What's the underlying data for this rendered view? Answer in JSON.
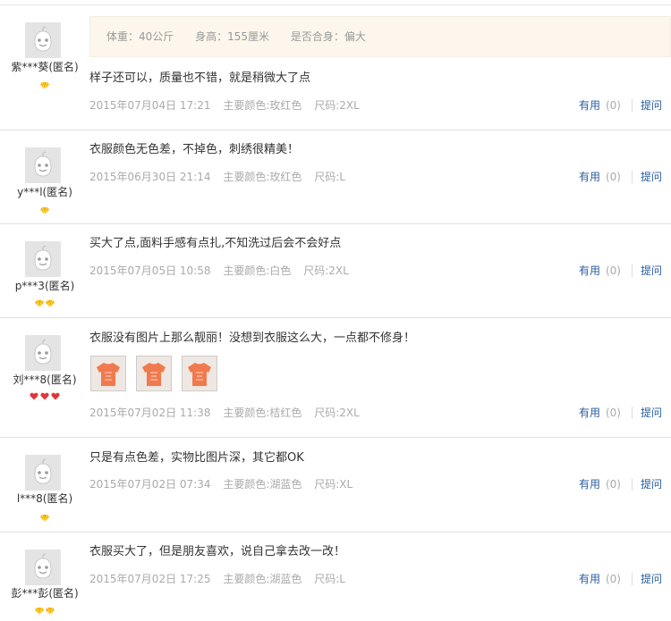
{
  "reviews": [
    {
      "user": "紫***葵(匿名)",
      "attrs": {
        "weight": "体重：40公斤",
        "height": "身高：155厘米",
        "fit": "是否合身：偏大"
      },
      "comment": "样子还可以，质量也不错，就是稍微大了点",
      "date": "2015年07月04日 17:21",
      "color": "主要颜色:玫红色",
      "size": "尺码:2XL",
      "useful": "有用",
      "count": "(0)",
      "reply": "提问",
      "badge_icon": "gold-diamond-icon",
      "badge_count": 1
    },
    {
      "user": "y***l(匿名)",
      "comment": "衣服颜色无色差，不掉色，刺绣很精美！",
      "date": "2015年06月30日 21:14",
      "color": "主要颜色:玫红色",
      "size": "尺码:L",
      "useful": "有用",
      "count": "(0)",
      "reply": "提问",
      "badge_icon": "gold-diamond-icon",
      "badge_count": 1
    },
    {
      "user": "p***3(匿名)",
      "comment": "买大了点,面料手感有点扎,不知洗过后会不会好点",
      "date": "2015年07月05日 10:58",
      "color": "主要颜色:白色",
      "size": "尺码:2XL",
      "useful": "有用",
      "count": "(0)",
      "reply": "提问",
      "badge_icon": "gold-diamond-icon",
      "badge_count": 2
    },
    {
      "user": "刘***8(匿名)",
      "comment": "衣服没有图片上那么靓丽！没想到衣服这么大，一点都不修身！",
      "date": "2015年07月02日 11:38",
      "color": "主要颜色:桔红色",
      "size": "尺码:2XL",
      "useful": "有用",
      "count": "(0)",
      "reply": "提问",
      "badge_icon": "red-heart-icon",
      "badge_count": 3,
      "has_photos": true
    },
    {
      "user": "l***8(匿名)",
      "comment": "只是有点色差，实物比图片深，其它都OK",
      "date": "2015年07月02日 07:34",
      "color": "主要颜色:湖蓝色",
      "size": "尺码:XL",
      "useful": "有用",
      "count": "(0)",
      "reply": "提问",
      "badge_icon": "gold-diamond-icon",
      "badge_count": 1
    },
    {
      "user": "彭***彭(匿名)",
      "comment": "衣服买大了，但是朋友喜欢，说自己拿去改一改！",
      "date": "2015年07月02日 17:25",
      "color": "主要颜色:湖蓝色",
      "size": "尺码:L",
      "useful": "有用",
      "count": "(0)",
      "reply": "提问",
      "badge_icon": "gold-diamond-icon",
      "badge_count": 2
    }
  ],
  "colors": {
    "link": "#2a5d9f",
    "meta": "#aaaaaa",
    "attr_bg": "#fdf6ec",
    "gold": "#f5b400",
    "red": "#e0353a",
    "photo": "#f07a4e"
  }
}
